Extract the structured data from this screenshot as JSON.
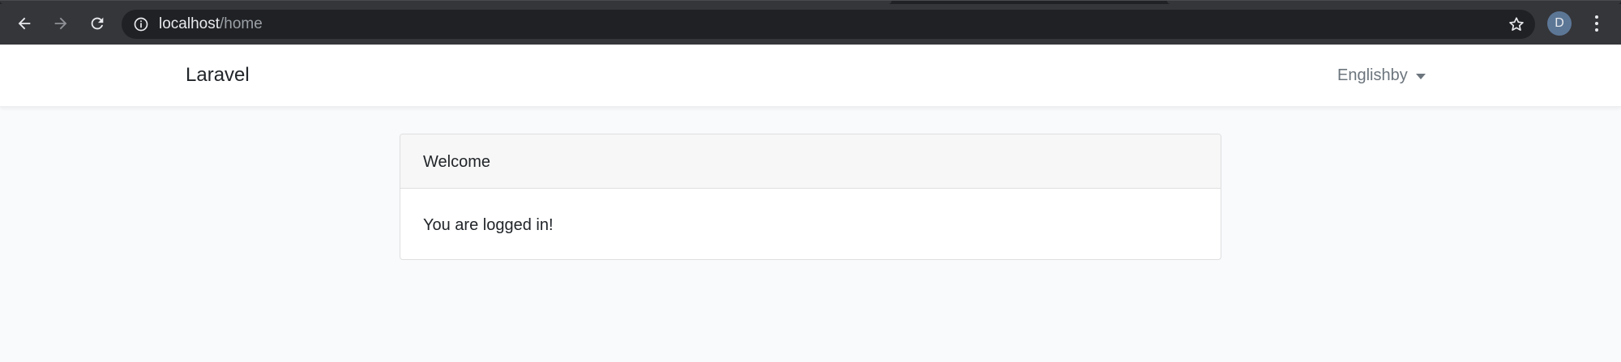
{
  "browser": {
    "url_host": "localhost",
    "url_path": "/home",
    "profile_initial": "D",
    "icons": {
      "back": "arrow-left-icon",
      "forward": "arrow-right-icon",
      "reload": "reload-icon",
      "site_info": "info-icon",
      "bookmark": "star-icon",
      "menu": "kebab-menu-icon"
    }
  },
  "navbar": {
    "brand": "Laravel",
    "language_label": "Englishby"
  },
  "card": {
    "header": "Welcome",
    "body": "You are logged in!"
  },
  "colors": {
    "chrome_bg": "#35363a",
    "omnibox_bg": "#202124",
    "page_bg": "#f8fafc",
    "avatar_bg": "#5c7796"
  }
}
